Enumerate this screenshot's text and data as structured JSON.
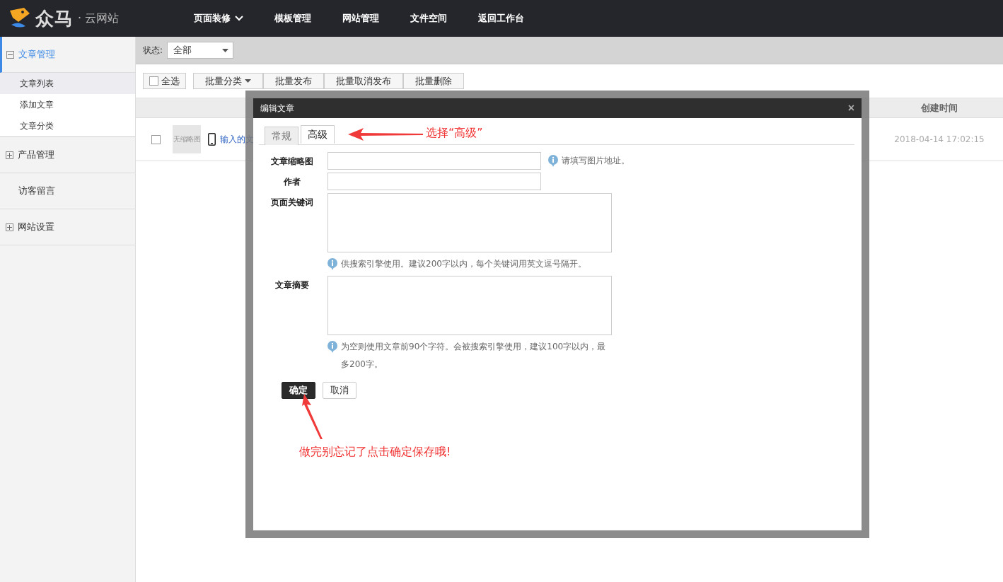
{
  "header": {
    "logo": {
      "brand": "众马",
      "sub": "· 云网站"
    },
    "nav": [
      {
        "label": "页面装修",
        "has_dropdown": true
      },
      {
        "label": "模板管理",
        "has_dropdown": false
      },
      {
        "label": "网站管理",
        "has_dropdown": false
      },
      {
        "label": "文件空间",
        "has_dropdown": false
      },
      {
        "label": "返回工作台",
        "has_dropdown": false
      }
    ]
  },
  "sidebar": {
    "groups": [
      {
        "kind": "group",
        "label": "文章管理",
        "selected": true,
        "expanded": true,
        "children": [
          {
            "label": "文章列表",
            "selected": true
          },
          {
            "label": "添加文章",
            "selected": false
          },
          {
            "label": "文章分类",
            "selected": false
          }
        ]
      },
      {
        "kind": "group",
        "label": "产品管理",
        "selected": false,
        "expanded": false
      },
      {
        "kind": "link",
        "label": "访客留言",
        "selected": false
      },
      {
        "kind": "group",
        "label": "网站设置",
        "selected": false,
        "expanded": false
      }
    ]
  },
  "filter": {
    "label": "状态:",
    "value": "全部"
  },
  "toolbar": {
    "select_all": {
      "label": "全选",
      "checked": false
    },
    "buttons": [
      {
        "label": "批量分类",
        "has_dropdown": true
      },
      {
        "label": "批量发布",
        "has_dropdown": false
      },
      {
        "label": "批量取消发布",
        "has_dropdown": false
      },
      {
        "label": "批量删除",
        "has_dropdown": false
      }
    ]
  },
  "table": {
    "columns": [
      {
        "label": "创建时间"
      }
    ],
    "rows": [
      {
        "checked": false,
        "thumbnail": "无缩略图",
        "title": "输入的文",
        "created": "2018-04-14 17:02:15"
      }
    ]
  },
  "dialog": {
    "title": "编辑文章",
    "close": "×",
    "tabs": [
      {
        "label": "常规",
        "selected": false
      },
      {
        "label": "高级",
        "selected": true
      }
    ],
    "fields": [
      {
        "kind": "input",
        "label": "文章缩略图",
        "hint": "请填写图片地址。"
      },
      {
        "kind": "input",
        "label": "作者"
      },
      {
        "kind": "textarea",
        "label": "页面关键词",
        "hint": "供搜索引擎使用。建议200字以内，每个关键词用英文逗号隔开。"
      },
      {
        "kind": "textarea",
        "label": "文章摘要",
        "hint": "为空则使用文章前90个字符。会被搜索引擎使用，建议100字以内，最多200字。"
      }
    ],
    "buttons": [
      {
        "label": "确定",
        "kind": "primary"
      },
      {
        "label": "取消",
        "kind": "default"
      }
    ],
    "annotations": [
      {
        "text": "选择“高级”",
        "kind": "left"
      },
      {
        "text": "做完别忘记了点击确定保存哦!",
        "kind": "up"
      }
    ]
  }
}
